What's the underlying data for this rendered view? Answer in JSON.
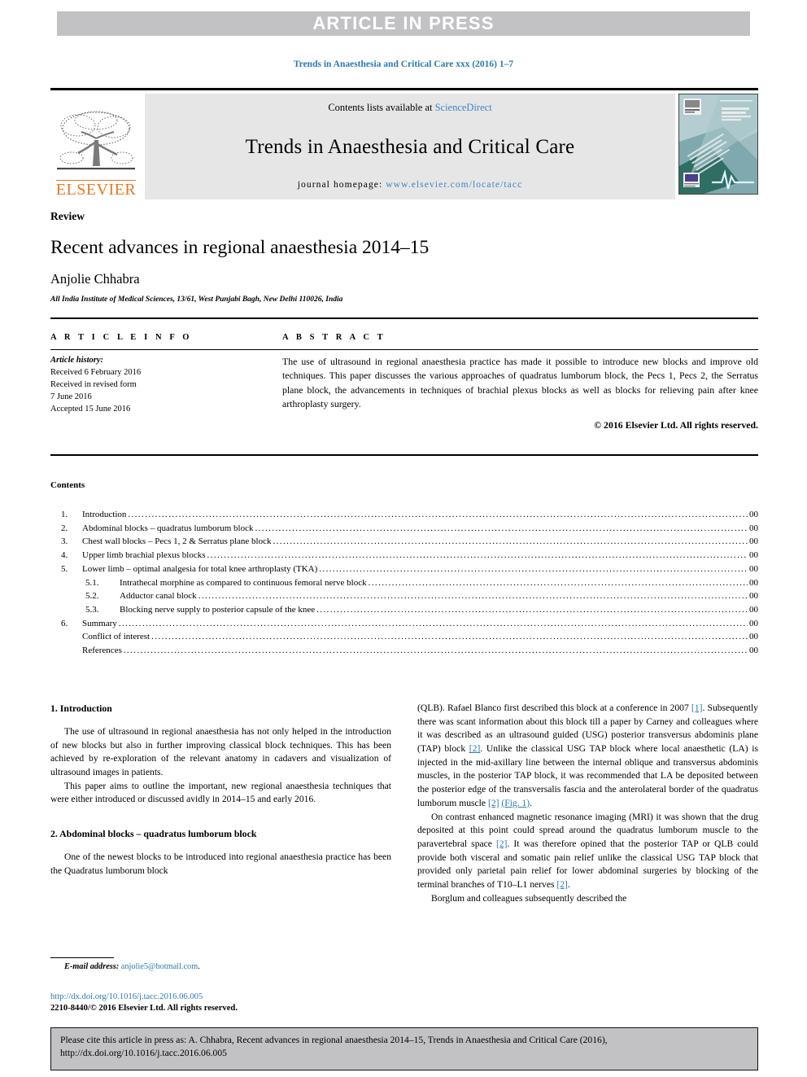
{
  "banner": {
    "label": "ARTICLE IN PRESS",
    "bg_color": "#c2c2c4"
  },
  "running_head": "Trends in Anaesthesia and Critical Care xxx (2016) 1–7",
  "masthead": {
    "publisher_name": "ELSEVIER",
    "publisher_logo_icon": "elsevier-tree-icon",
    "contents_available_prefix": "Contents lists available at ",
    "contents_available_link": "ScienceDirect",
    "journal_title": "Trends in Anaesthesia and Critical Care",
    "homepage_prefix": "journal homepage: ",
    "homepage_url": "www.elsevier.com/locate/tacc",
    "cover_thumbnail_icon": "journal-cover-thumbnail",
    "link_color": "#3a86c8",
    "panel_bg": "#e6e6e6"
  },
  "article": {
    "doc_type": "Review",
    "title": "Recent advances in regional anaesthesia 2014–15",
    "author": "Anjolie Chhabra",
    "affiliation": "All India Institute of Medical Sciences, 13/61, West Punjabi Bagh, New Delhi 110026, India"
  },
  "article_info": {
    "heading": "A R T I C L E   I N F O",
    "history_label": "Article history:",
    "history_lines": [
      "Received 6 February 2016",
      "Received in revised form",
      "7 June 2016",
      "Accepted 15 June 2016"
    ]
  },
  "abstract": {
    "heading": "A B S T R A C T",
    "text": "The use of ultrasound in regional anaesthesia practice has made it possible to introduce new blocks and improve old techniques. This paper discusses the various approaches of quadratus lumborum block, the Pecs 1, Pecs 2, the Serratus plane block, the advancements in techniques of brachial plexus blocks as well as blocks for relieving pain after knee arthroplasty surgery.",
    "copyright": "© 2016 Elsevier Ltd. All rights reserved."
  },
  "contents": {
    "label": "Contents",
    "items": [
      {
        "num": "1.",
        "level": 1,
        "label": "Introduction",
        "page": "00"
      },
      {
        "num": "2.",
        "level": 1,
        "label": "Abdominal blocks – quadratus lumborum block",
        "page": "00"
      },
      {
        "num": "3.",
        "level": 1,
        "label": "Chest wall blocks – Pecs 1, 2 & Serratus plane block",
        "page": "00"
      },
      {
        "num": "4.",
        "level": 1,
        "label": "Upper limb brachial plexus blocks",
        "page": "00"
      },
      {
        "num": "5.",
        "level": 1,
        "label": "Lower limb – optimal analgesia for total knee arthroplasty (TKA)",
        "page": "00"
      },
      {
        "num": "5.1.",
        "level": 2,
        "label": "Intrathecal morphine as compared to continuous femoral nerve block",
        "page": "00"
      },
      {
        "num": "5.2.",
        "level": 2,
        "label": "Adductor canal block",
        "page": "00"
      },
      {
        "num": "5.3.",
        "level": 2,
        "label": "Blocking nerve supply to posterior capsule of the knee",
        "page": "00"
      },
      {
        "num": "6.",
        "level": 1,
        "label": "Summary",
        "page": "00"
      },
      {
        "num": "",
        "level": 1,
        "label": "Conflict of interest",
        "page": "00"
      },
      {
        "num": "",
        "level": 1,
        "label": "References",
        "page": "00"
      }
    ]
  },
  "body": {
    "left": {
      "section1_heading": "1.  Introduction",
      "para1": "The use of ultrasound in regional anaesthesia has not only helped in the introduction of new blocks but also in further improving classical block techniques. This has been achieved by re-exploration of the relevant anatomy in cadavers and visualization of ultrasound images in patients.",
      "para2": "This paper aims to outline the important, new regional anaesthesia techniques that were either introduced or discussed avidly in 2014–15 and early 2016.",
      "section2_heading": "2.  Abdominal blocks – quadratus lumborum block",
      "para3": "One of the newest blocks to be introduced into regional anaesthesia practice has been the Quadratus lumborum block"
    },
    "right": {
      "para1_a": "(QLB). Rafael Blanco first described this block at a conference in 2007 ",
      "para1_ref1": "[1]",
      "para1_b": ". Subsequently there was scant information about this block till a paper by Carney and colleagues where it was described as an ultrasound guided (USG) posterior transversus abdominis plane (TAP) block ",
      "para1_ref2": "[2]",
      "para1_c": ". Unlike the classical USG TAP block where local anaesthetic (LA) is injected in the mid-axillary line between the internal oblique and transversus abdominis muscles, in the posterior TAP block, it was recommended that LA be deposited between the posterior edge of the transversalis fascia and the anterolateral border of the quadratus lumborum muscle ",
      "para1_ref3": "[2]",
      "para1_d": " ",
      "para1_fig": "(Fig. 1)",
      "para1_e": ".",
      "para2_a": "On contrast enhanced magnetic resonance imaging (MRI) it was shown that the drug deposited at this point could spread around the quadratus lumborum muscle to the paravertebral space ",
      "para2_ref1": "[2]",
      "para2_b": ". It was therefore opined that the posterior TAP or QLB could provide both visceral and somatic pain relief unlike the classical USG TAP block that provided only parietal pain relief for lower abdominal surgeries by blocking of the terminal branches of T10–L1 nerves ",
      "para2_ref2": "[2]",
      "para2_c": ".",
      "para3": "Borglum and colleagues subsequently described the"
    }
  },
  "footnote": {
    "email_label": "E-mail address:",
    "email_address": "anjolie5@hotmail.com",
    "email_trailing": "."
  },
  "imprint": {
    "doi_url": "http://dx.doi.org/10.1016/j.tacc.2016.06.005",
    "issn_line": "2210-8440/© 2016 Elsevier Ltd. All rights reserved."
  },
  "cite_box": {
    "line1": "Please cite this article in press as: A. Chhabra, Recent advances in regional anaesthesia 2014–15, Trends in Anaesthesia and Critical Care (2016),",
    "line2": "http://dx.doi.org/10.1016/j.tacc.2016.06.005",
    "bg_color": "#c2c2c4"
  },
  "colors": {
    "link_blue": "#2a7ab0",
    "elsevier_orange": "#e87722",
    "panel_gray": "#e6e6e6",
    "banner_gray": "#c2c2c4"
  }
}
